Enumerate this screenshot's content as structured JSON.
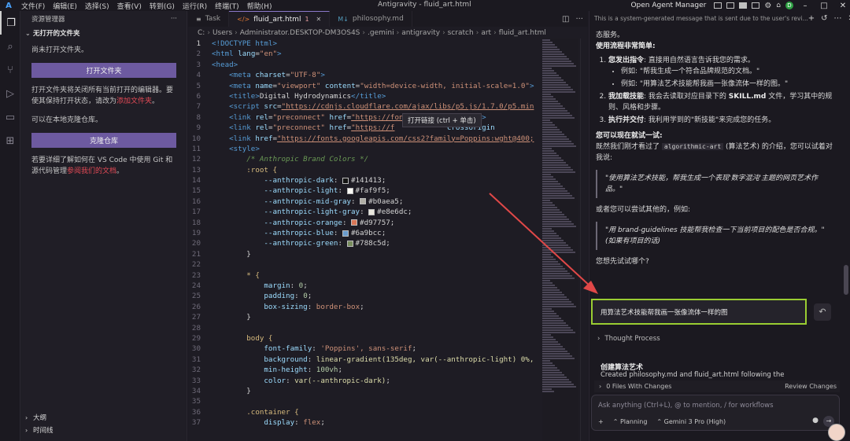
{
  "titlebar": {
    "menus": [
      "文件(F)",
      "编辑(E)",
      "选择(S)",
      "查看(V)",
      "转到(G)",
      "运行(R)",
      "终端(T)",
      "帮助(H)"
    ],
    "title": "Antigravity - fluid_art.html",
    "agent_manager": "Open Agent Manager",
    "account_initial": "D"
  },
  "explorer": {
    "header": "资源管理器",
    "section": "无打开的文件夹",
    "no_folder_text": "尚未打开文件夹。",
    "open_folder_button": "打开文件夹",
    "info_text_a": "打开文件夹将关闭所有当前打开的编辑器。要使其保持打开状态，请改为",
    "info_link": "添加文件夹",
    "info_text_b": "。",
    "clone_hint": "可以在本地克隆仓库。",
    "clone_button": "克隆仓库",
    "git_text": "若要详细了解如何在 VS Code 中使用 Git 和源代码管理",
    "git_link": "参阅我们的文档",
    "git_text_end": "。",
    "outline": "大纲",
    "timeline": "时间线"
  },
  "tabs": [
    {
      "label": "Task",
      "icon": "task-icon"
    },
    {
      "label": "fluid_art.html",
      "icon": "html-file-icon",
      "active": true,
      "badge": "1"
    },
    {
      "label": "philosophy.md",
      "icon": "markdown-file-icon"
    }
  ],
  "breadcrumb": [
    "C:",
    "Users",
    "Administrator.DESKTOP-DM3OS4S",
    ".gemini",
    "antigravity",
    "scratch",
    "art",
    "fluid_art.html"
  ],
  "tooltip": "打开链接 (ctrl + 单击)",
  "code_lines": [
    "1",
    "2",
    "3",
    "4",
    "5",
    "6",
    "7",
    "8",
    "9",
    "10",
    "11",
    "12",
    "13",
    "14",
    "15",
    "16",
    "17",
    "18",
    "19",
    "20",
    "21",
    "22",
    "23",
    "24",
    "25",
    "26",
    "27",
    "28",
    "29",
    "30",
    "31",
    "32",
    "33",
    "34",
    "35",
    "36",
    "37"
  ],
  "code": {
    "doctype": "<!DOCTYPE html>",
    "html_open": "<html lang=\"en\">",
    "head_open": "<head>",
    "meta_charset": "UTF-8",
    "meta_viewport": "width=device-width, initial-scale=1.0",
    "title": "Digital Hydrodynamics",
    "script_src": "https://cdnjs.cloudflare.com/ajax/libs/p5.js/1.7.0/p5.min",
    "preconnect1": "https://fonts.googleapis.com",
    "preconnect2": "https://f",
    "crossorigin": "crossorigin",
    "fonts_href": "https://fonts.googleapis.com/css2?family=Poppins:wght@400;",
    "style_open": "<style>",
    "comment": "/* Anthropic Brand Colors */",
    "root": ":root {",
    "vars": [
      {
        "name": "--anthropic-dark",
        "value": "#141413",
        "color": "#141413"
      },
      {
        "name": "--anthropic-light",
        "value": "#faf9f5",
        "color": "#faf9f5"
      },
      {
        "name": "--anthropic-mid-gray",
        "value": "#b0aea5",
        "color": "#b0aea5"
      },
      {
        "name": "--anthropic-light-gray",
        "value": "#e8e6dc",
        "color": "#e8e6dc"
      },
      {
        "name": "--anthropic-orange",
        "value": "#d97757",
        "color": "#d97757"
      },
      {
        "name": "--anthropic-blue",
        "value": "#6a9bcc",
        "color": "#6a9bcc"
      },
      {
        "name": "--anthropic-green",
        "value": "#788c5d",
        "color": "#788c5d"
      }
    ],
    "star_margin": "0",
    "star_padding": "0",
    "star_box": "border-box",
    "body_font": "'Poppins', sans-serif",
    "body_bg": "linear-gradient(135deg, var(--anthropic-light) 0%,",
    "body_minh": "100vh",
    "body_color": "var(--anthropic-dark)",
    "container_display": "flex"
  },
  "agent": {
    "header_note": "This is a system-generated message that is sent due to the user's revi...",
    "intro_tail": "态服务。",
    "flow_title": "使用流程非常简单:",
    "step1_title": "您发出指令",
    "step1_text": ": 直接用自然语言告诉我您的需求。",
    "step1_ex1": "例如: \"帮我生成一个符合品牌规范的文档。\"",
    "step1_ex2": "例如: \"用算法艺术技能帮我画一张像流体一样的图。\"",
    "step2_title": "我加载技能",
    "step2_text_a": ": 我会去读取对应目录下的",
    "step2_code": "SKILL.md",
    "step2_text_b": "文件，学习其中的规则、风格和步骤。",
    "step3_title": "执行并交付",
    "step3_text": ": 我利用学到的\"新技能\"来完成您的任务。",
    "try_title": "您可以现在就试一试:",
    "try_text_a": "既然我们刚才看过了",
    "try_code": "algorithmic-art",
    "try_text_b": "(算法艺术) 的介绍，您可以试着对我说:",
    "quote1": "\"使用算法艺术技能，帮我生成一个表现'数字混沌'主题的网页艺术作品。\"",
    "or_text": "或者您可以尝试其他的，例如:",
    "quote2": "\"用 brand-guidelines 技能帮我检查一下当前项目的配色是否合规。\" (如果有项目的话)",
    "question": "您想先试试哪个?",
    "user_message": "用算法艺术技能帮我画一张像流体一样的图",
    "thought_process": "Thought Process",
    "task_title": "创建算法艺术",
    "task_line": "Created  philosophy.md  and  fluid_art.html  following the",
    "files_changed": "0 Files With Changes",
    "review_changes": "Review Changes",
    "input_placeholder": "Ask anything (Ctrl+L), @ to mention, / for workflows",
    "mode": "Planning",
    "model": "Gemini 3 Pro (High)"
  }
}
